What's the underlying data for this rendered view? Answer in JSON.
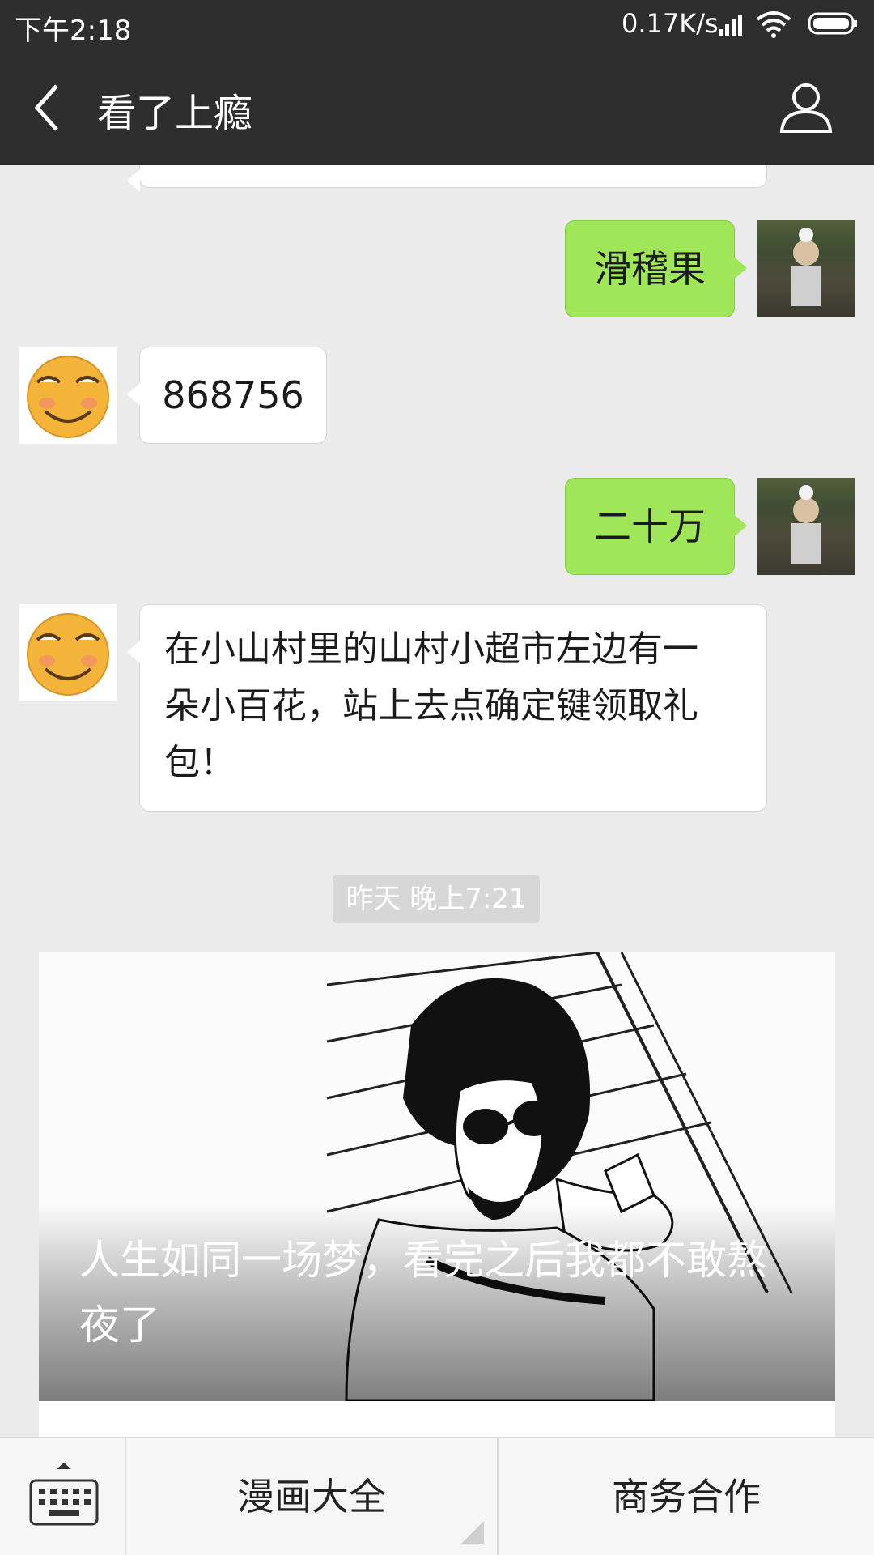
{
  "status_bar": {
    "time": "下午2:18",
    "network_speed": "0.17K/s",
    "icons": [
      "signal-icon",
      "wifi-icon",
      "battery-icon"
    ]
  },
  "header": {
    "title": "看了上瘾",
    "back_icon": "chevron-left-icon",
    "profile_icon": "person-icon"
  },
  "messages": [
    {
      "side": "right",
      "text": "滑稽果",
      "avatar": "user-avatar"
    },
    {
      "side": "left",
      "text": "868756",
      "avatar": "smiley-avatar"
    },
    {
      "side": "right",
      "text": "二十万",
      "avatar": "user-avatar"
    },
    {
      "side": "left",
      "lines": [
        "在小山村里的山村小超市左边有一",
        "朵小百花，站上去点确定键领取礼",
        "包！"
      ],
      "avatar": "smiley-avatar"
    }
  ],
  "timestamp": "昨天 晚上7:21",
  "article_card": {
    "caption_lines": [
      "人生如同一场梦，看完之后我都不敢熬",
      "夜了"
    ]
  },
  "menu": {
    "keyboard_icon": "keyboard-icon",
    "items": [
      "漫画大全",
      "商务合作"
    ]
  },
  "colors": {
    "bar": "#2e2e2e",
    "background": "#ebebeb",
    "sent_bubble": "#9fe659",
    "received_bubble": "#ffffff"
  }
}
